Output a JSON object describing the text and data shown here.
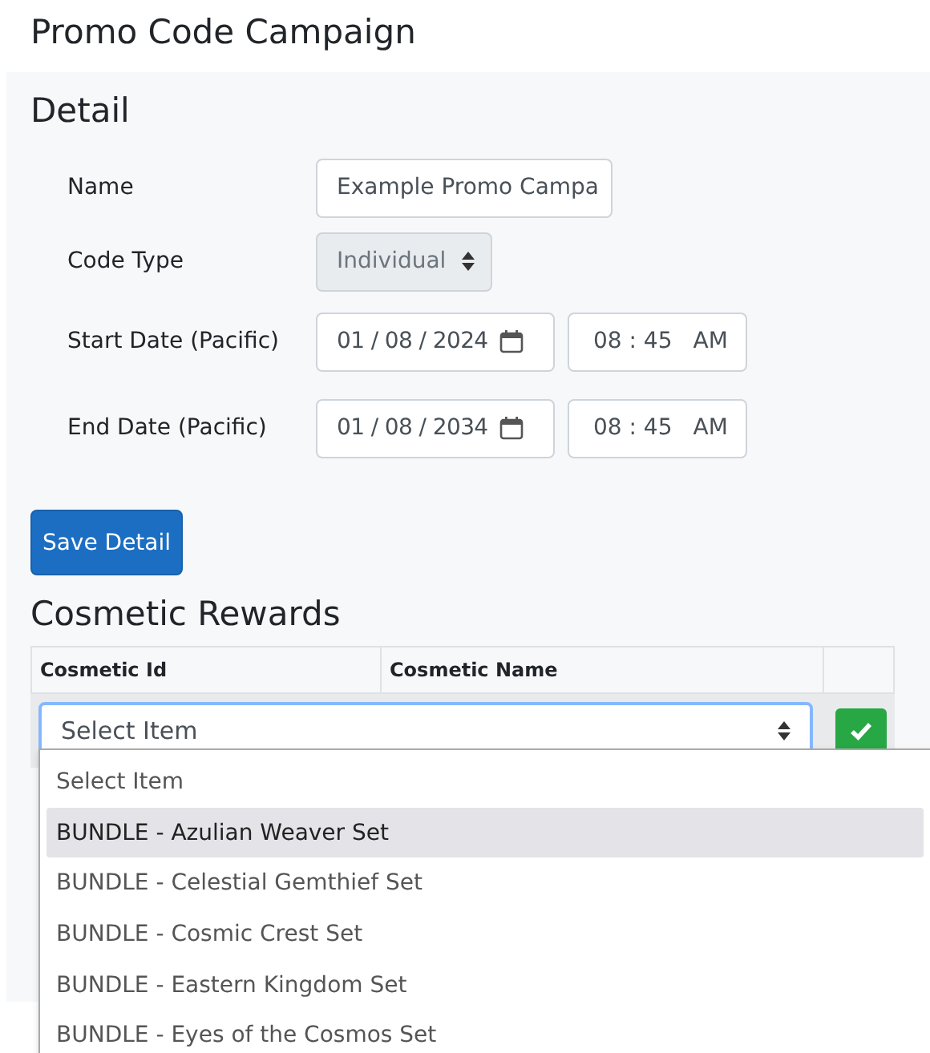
{
  "page_title": "Promo Code Campaign",
  "detail": {
    "heading": "Detail",
    "fields": [
      {
        "kind": "text",
        "label": "Name",
        "value": "Example Promo Campa"
      },
      {
        "kind": "select",
        "label": "Code Type",
        "value": "Individual",
        "disabled": true
      },
      {
        "kind": "datetime",
        "label": "Start Date (Pacific)",
        "date": "01 / 08 / 2024",
        "time": "08 : 45",
        "ampm": "AM"
      },
      {
        "kind": "datetime",
        "label": "End Date (Pacific)",
        "date": "01 / 08 / 2034",
        "time": "08 : 45",
        "ampm": "AM"
      }
    ],
    "save_button": "Save Detail"
  },
  "rewards": {
    "heading": "Cosmetic Rewards",
    "columns": [
      "Cosmetic Id",
      "Cosmetic Name"
    ],
    "select_value": "Select Item",
    "dropdown_options": [
      {
        "label": "Select Item",
        "selected": false
      },
      {
        "label": "BUNDLE - Azulian Weaver Set",
        "selected": true
      },
      {
        "label": "BUNDLE - Celestial Gemthief Set",
        "selected": false
      },
      {
        "label": "BUNDLE - Cosmic Crest Set",
        "selected": false
      },
      {
        "label": "BUNDLE - Eastern Kingdom Set",
        "selected": false
      },
      {
        "label": "BUNDLE - Eyes of the Cosmos Set",
        "selected": false
      }
    ]
  }
}
